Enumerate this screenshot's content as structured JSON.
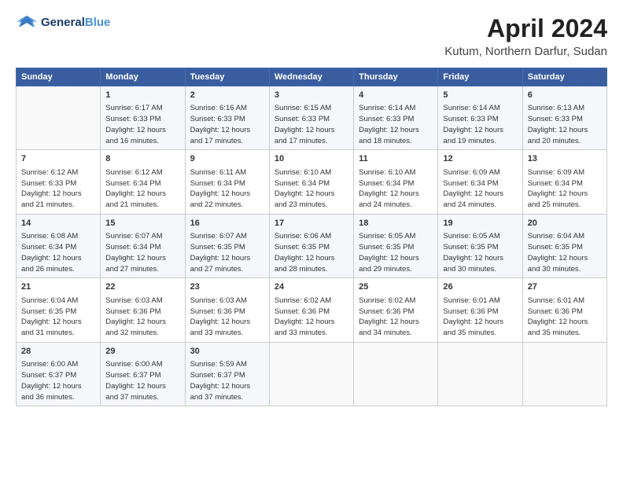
{
  "logo": {
    "line1": "General",
    "line2": "Blue"
  },
  "title": "April 2024",
  "location": "Kutum, Northern Darfur, Sudan",
  "days_header": [
    "Sunday",
    "Monday",
    "Tuesday",
    "Wednesday",
    "Thursday",
    "Friday",
    "Saturday"
  ],
  "weeks": [
    [
      {
        "day": "",
        "info": ""
      },
      {
        "day": "1",
        "info": "Sunrise: 6:17 AM\nSunset: 6:33 PM\nDaylight: 12 hours\nand 16 minutes."
      },
      {
        "day": "2",
        "info": "Sunrise: 6:16 AM\nSunset: 6:33 PM\nDaylight: 12 hours\nand 17 minutes."
      },
      {
        "day": "3",
        "info": "Sunrise: 6:15 AM\nSunset: 6:33 PM\nDaylight: 12 hours\nand 17 minutes."
      },
      {
        "day": "4",
        "info": "Sunrise: 6:14 AM\nSunset: 6:33 PM\nDaylight: 12 hours\nand 18 minutes."
      },
      {
        "day": "5",
        "info": "Sunrise: 6:14 AM\nSunset: 6:33 PM\nDaylight: 12 hours\nand 19 minutes."
      },
      {
        "day": "6",
        "info": "Sunrise: 6:13 AM\nSunset: 6:33 PM\nDaylight: 12 hours\nand 20 minutes."
      }
    ],
    [
      {
        "day": "7",
        "info": "Sunrise: 6:12 AM\nSunset: 6:33 PM\nDaylight: 12 hours\nand 21 minutes."
      },
      {
        "day": "8",
        "info": "Sunrise: 6:12 AM\nSunset: 6:34 PM\nDaylight: 12 hours\nand 21 minutes."
      },
      {
        "day": "9",
        "info": "Sunrise: 6:11 AM\nSunset: 6:34 PM\nDaylight: 12 hours\nand 22 minutes."
      },
      {
        "day": "10",
        "info": "Sunrise: 6:10 AM\nSunset: 6:34 PM\nDaylight: 12 hours\nand 23 minutes."
      },
      {
        "day": "11",
        "info": "Sunrise: 6:10 AM\nSunset: 6:34 PM\nDaylight: 12 hours\nand 24 minutes."
      },
      {
        "day": "12",
        "info": "Sunrise: 6:09 AM\nSunset: 6:34 PM\nDaylight: 12 hours\nand 24 minutes."
      },
      {
        "day": "13",
        "info": "Sunrise: 6:09 AM\nSunset: 6:34 PM\nDaylight: 12 hours\nand 25 minutes."
      }
    ],
    [
      {
        "day": "14",
        "info": "Sunrise: 6:08 AM\nSunset: 6:34 PM\nDaylight: 12 hours\nand 26 minutes."
      },
      {
        "day": "15",
        "info": "Sunrise: 6:07 AM\nSunset: 6:34 PM\nDaylight: 12 hours\nand 27 minutes."
      },
      {
        "day": "16",
        "info": "Sunrise: 6:07 AM\nSunset: 6:35 PM\nDaylight: 12 hours\nand 27 minutes."
      },
      {
        "day": "17",
        "info": "Sunrise: 6:06 AM\nSunset: 6:35 PM\nDaylight: 12 hours\nand 28 minutes."
      },
      {
        "day": "18",
        "info": "Sunrise: 6:05 AM\nSunset: 6:35 PM\nDaylight: 12 hours\nand 29 minutes."
      },
      {
        "day": "19",
        "info": "Sunrise: 6:05 AM\nSunset: 6:35 PM\nDaylight: 12 hours\nand 30 minutes."
      },
      {
        "day": "20",
        "info": "Sunrise: 6:04 AM\nSunset: 6:35 PM\nDaylight: 12 hours\nand 30 minutes."
      }
    ],
    [
      {
        "day": "21",
        "info": "Sunrise: 6:04 AM\nSunset: 6:35 PM\nDaylight: 12 hours\nand 31 minutes."
      },
      {
        "day": "22",
        "info": "Sunrise: 6:03 AM\nSunset: 6:36 PM\nDaylight: 12 hours\nand 32 minutes."
      },
      {
        "day": "23",
        "info": "Sunrise: 6:03 AM\nSunset: 6:36 PM\nDaylight: 12 hours\nand 33 minutes."
      },
      {
        "day": "24",
        "info": "Sunrise: 6:02 AM\nSunset: 6:36 PM\nDaylight: 12 hours\nand 33 minutes."
      },
      {
        "day": "25",
        "info": "Sunrise: 6:02 AM\nSunset: 6:36 PM\nDaylight: 12 hours\nand 34 minutes."
      },
      {
        "day": "26",
        "info": "Sunrise: 6:01 AM\nSunset: 6:36 PM\nDaylight: 12 hours\nand 35 minutes."
      },
      {
        "day": "27",
        "info": "Sunrise: 6:01 AM\nSunset: 6:36 PM\nDaylight: 12 hours\nand 35 minutes."
      }
    ],
    [
      {
        "day": "28",
        "info": "Sunrise: 6:00 AM\nSunset: 6:37 PM\nDaylight: 12 hours\nand 36 minutes."
      },
      {
        "day": "29",
        "info": "Sunrise: 6:00 AM\nSunset: 6:37 PM\nDaylight: 12 hours\nand 37 minutes."
      },
      {
        "day": "30",
        "info": "Sunrise: 5:59 AM\nSunset: 6:37 PM\nDaylight: 12 hours\nand 37 minutes."
      },
      {
        "day": "",
        "info": ""
      },
      {
        "day": "",
        "info": ""
      },
      {
        "day": "",
        "info": ""
      },
      {
        "day": "",
        "info": ""
      }
    ]
  ]
}
